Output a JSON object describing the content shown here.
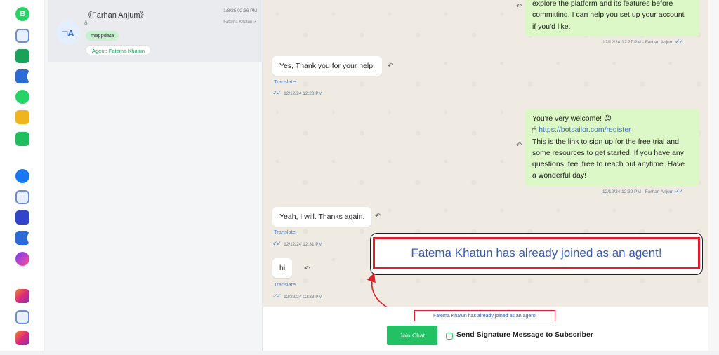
{
  "rail": {
    "icons": [
      "whatsapp-business-icon",
      "bot-icon",
      "phone-icon",
      "flag-icon",
      "whatsapp-icon",
      "puzzle-icon",
      "shopping-bag-icon",
      "facebook-icon",
      "bot-icon",
      "call-icon",
      "flag-icon",
      "messenger-icon",
      "instagram-icon",
      "bot-icon",
      "instagram-call-icon"
    ],
    "labels": {
      "wa_business": "B"
    }
  },
  "conversation": {
    "avatar": "□A",
    "name": "《Farhan Anjum》",
    "sub": "ä",
    "time": "1/8/25 02:36 PM",
    "agent_small": "Fatema Khatun ✔",
    "label_chip": "mappdata",
    "agent_chip": "Agent: Fatema Khatun"
  },
  "messages": {
    "m1": {
      "line1": "explore the platform and its features before",
      "line2": "committing. I can help you set up your account",
      "line3": "if you'd like.",
      "meta": "12/12/24 12:27 PM - Farhan Anjum"
    },
    "m2": {
      "text": "Yes, Thank you for your help.",
      "translate": "Translate",
      "meta": "12/12/24 12:28 PM"
    },
    "m3": {
      "line1": "You're very welcome! 😊",
      "link": "https://botsailor.com/register",
      "line3": "This is the link to sign up for the free trial and",
      "line4": "some resources to get started. If you have any",
      "line5": "questions, feel free to reach out anytime. Have",
      "line6": "a wonderful day!",
      "meta": "12/12/24 12:30 PM - Farhan Anjum"
    },
    "m4": {
      "text": "Yeah, I will. Thanks again.",
      "translate": "Translate",
      "meta": "12/12/24 12:31 PM"
    },
    "m5": {
      "text": "hi",
      "translate": "Translate",
      "meta": "12/22/24 02:33 PM"
    }
  },
  "highlight": {
    "text": "Fatema Khatun has already joined as an agent!"
  },
  "bottom": {
    "notice": "Fatema Khatun has already joined as an agent!",
    "join_label": "Join Chat",
    "signature_label": "Send Signature Message to Subscriber"
  },
  "colors": {
    "accent_green": "#21c164",
    "highlight_red": "#e41e26",
    "outgoing_bubble": "#dcf8c6"
  }
}
